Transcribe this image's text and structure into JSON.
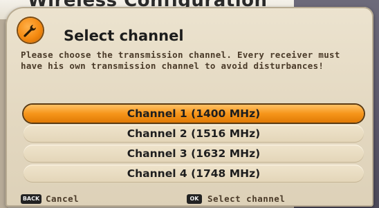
{
  "background_screen": {
    "title": "Wireless Configuration"
  },
  "dialog": {
    "icon": "wrench-icon",
    "title": "Select channel",
    "description": "Please choose the transmission channel. Every receiver must have his own transmission channel to avoid disturbances!",
    "channels": [
      {
        "label": "Channel 1 (1400 MHz)",
        "selected": true
      },
      {
        "label": "Channel 2 (1516 MHz)",
        "selected": false
      },
      {
        "label": "Channel 3 (1632 MHz)",
        "selected": false
      },
      {
        "label": "Channel 4 (1748 MHz)",
        "selected": false
      }
    ]
  },
  "footer": {
    "back_key": "BACK",
    "back_label": "Cancel",
    "ok_key": "OK",
    "ok_label": "Select channel"
  },
  "colors": {
    "accent": "#f6951a",
    "panel": "#e4d9c2",
    "text_brown": "#4a3a28"
  }
}
